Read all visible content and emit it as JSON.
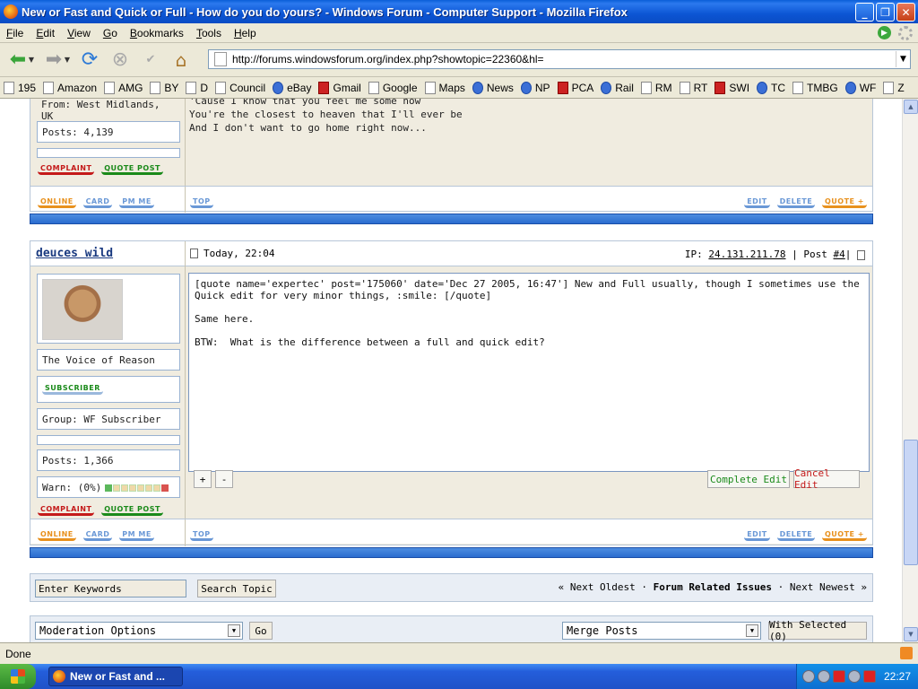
{
  "window": {
    "title": "New or Fast and Quick or Full - How do you do yours? - Windows Forum - Computer Support - Mozilla Firefox"
  },
  "menu": [
    "File",
    "Edit",
    "View",
    "Go",
    "Bookmarks",
    "Tools",
    "Help"
  ],
  "nav": {
    "url": "http://forums.windowsforum.org/index.php?showtopic=22360&hl="
  },
  "bookmarks": [
    "195",
    "Amazon",
    "AMG",
    "BY",
    "D",
    "Council",
    "eBay",
    "Gmail",
    "Google",
    "Maps",
    "News",
    "NP",
    "PCA",
    "Rail",
    "RM",
    "RT",
    "SWI",
    "TC",
    "TMBG",
    "WF",
    "Z"
  ],
  "prev_post": {
    "from": "From: West Midlands, UK",
    "posts": "Posts: 4,139",
    "complaint": "COMPLAINT",
    "quote_post": "QUOTE POST",
    "lyrics": [
      "'Cause I know that you feel me some how",
      "You're the closest to heaven that I'll ever be",
      "And I don't want to go home right now..."
    ],
    "online": "ONLINE",
    "card": "CARD",
    "pm": "PM ME",
    "top": "TOP",
    "edit": "EDIT",
    "delete": "DELETE",
    "quoteplus": "QUOTE +"
  },
  "post": {
    "author": "deuces wild",
    "date": "Today, 22:04",
    "ip_label": "IP:",
    "ip": "24.131.211.78",
    "post_label": "| Post",
    "post_num": "#4",
    "tagline": "The Voice of Reason",
    "subscriber": "SUBSCRIBER",
    "group": "Group: WF Subscriber",
    "posts": "Posts: 1,366",
    "warn": "Warn: (0%)",
    "warn_level": 0,
    "complaint": "COMPLAINT",
    "quote_post": "QUOTE POST",
    "edit_text": "[quote name='expertec' post='175060' date='Dec 27 2005, 16:47'] New and Full usually, though I sometimes use the Quick edit for very minor things, :smile: [/quote]\n\nSame here.\n\nBTW:  What is the difference between a full and quick edit?",
    "plus": "+",
    "minus": "-",
    "complete_edit": "Complete Edit",
    "cancel_edit": "Cancel Edit",
    "online": "ONLINE",
    "card": "CARD",
    "pm": "PM ME",
    "top": "TOP",
    "edit": "EDIT",
    "delete": "DELETE",
    "quoteplus": "QUOTE +"
  },
  "search": {
    "placeholder": "Enter Keywords",
    "button": "Search Topic",
    "next_oldest": "« Next Oldest",
    "sep1": "·",
    "forum": "Forum Related Issues",
    "sep2": "·",
    "next_newest": "Next Newest »"
  },
  "moderation": {
    "options": "Moderation Options",
    "go": "Go",
    "merge": "Merge Posts",
    "with_selected": "With Selected (0)"
  },
  "status": "Done",
  "taskbar": {
    "item": "New or Fast and ...",
    "clock": "22:27"
  },
  "colors": {
    "titlebar": "#0c55d4",
    "post_bg": "#f0ece0",
    "blue_bar": "#2a6ccf",
    "complaint": "#c41a1a",
    "quote": "#1a8a1a"
  }
}
